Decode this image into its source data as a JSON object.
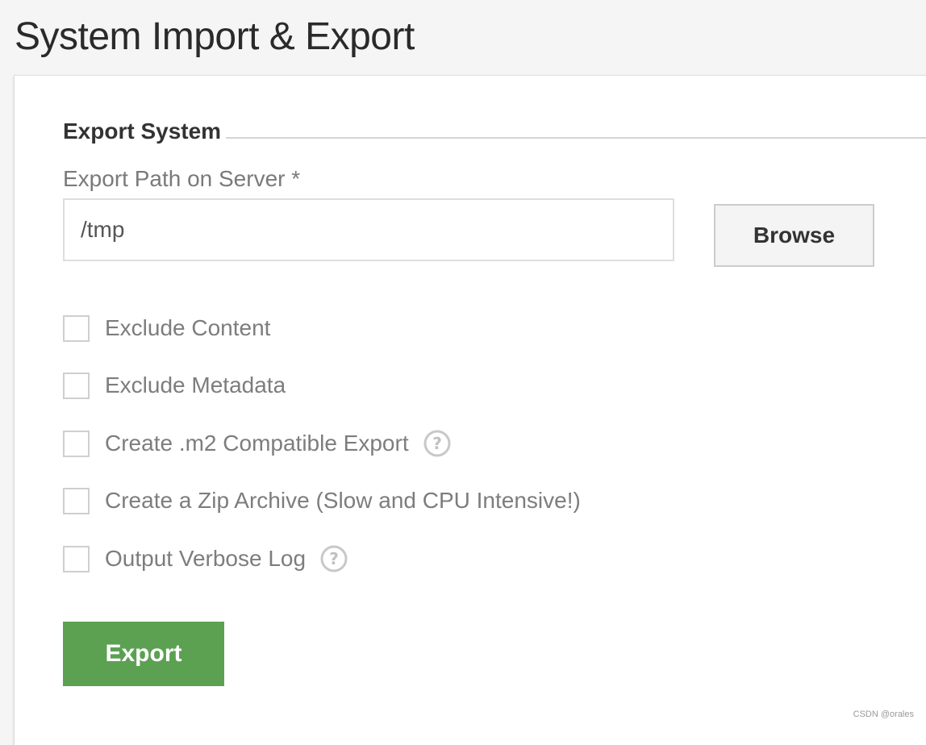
{
  "page": {
    "title": "System Import & Export"
  },
  "export_section": {
    "legend": "Export System",
    "path_label": "Export Path on Server *",
    "path_value": "/tmp",
    "browse_label": "Browse",
    "options": [
      {
        "label": "Exclude Content",
        "checked": false,
        "has_help": false
      },
      {
        "label": "Exclude Metadata",
        "checked": false,
        "has_help": false
      },
      {
        "label": "Create .m2 Compatible Export",
        "checked": false,
        "has_help": true
      },
      {
        "label": "Create a Zip Archive (Slow and CPU Intensive!)",
        "checked": false,
        "has_help": false
      },
      {
        "label": "Output Verbose Log",
        "checked": false,
        "has_help": true
      }
    ],
    "export_label": "Export"
  },
  "icons": {
    "help": "help-circle-icon"
  },
  "colors": {
    "export_button": "#5ca152",
    "page_background": "#f5f5f5",
    "panel_background": "#ffffff"
  },
  "watermark": "CSDN @orales"
}
